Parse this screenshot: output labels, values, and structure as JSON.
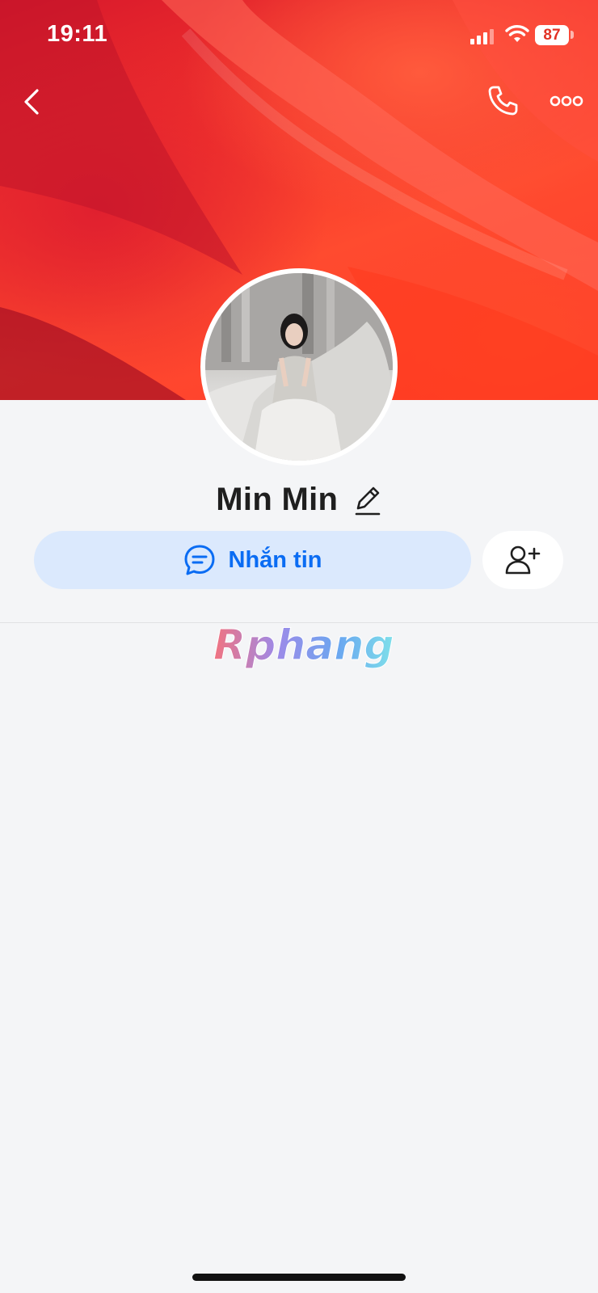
{
  "status_bar": {
    "time": "19:11",
    "battery": "87"
  },
  "profile": {
    "name": "Min Min"
  },
  "actions": {
    "message_label": "Nhắn tin"
  },
  "watermark": {
    "text": "Rphang"
  },
  "icons": {
    "back": "chevron-left-icon",
    "phone": "phone-icon",
    "more": "more-dots-icon",
    "edit": "pencil-icon",
    "message": "chat-bubble-icon",
    "add_friend": "add-user-icon"
  },
  "colors": {
    "accent": "#0a6cf3",
    "message_button_bg": "#dbe9fd",
    "background": "#f4f5f7",
    "cover": "#f2342c"
  }
}
